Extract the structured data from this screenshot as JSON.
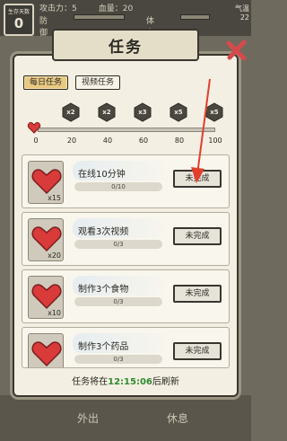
{
  "hud": {
    "box_label": "生存天数",
    "box_value": "0",
    "attack": "攻击力：5",
    "defense": "防御",
    "blood": "血量：20",
    "stamina": "体力",
    "weather": "气温",
    "weather_value": "22"
  },
  "panel": {
    "title": "任务",
    "tabs": [
      {
        "label": "每日任务",
        "active": true
      },
      {
        "label": "视频任务",
        "active": false
      }
    ]
  },
  "milestones": {
    "ticks": [
      "0",
      "20",
      "40",
      "60",
      "80",
      "100"
    ],
    "chests": [
      "x2",
      "x2",
      "x3",
      "x5",
      "x5"
    ],
    "progress": 0
  },
  "tasks": [
    {
      "title": "在线10分钟",
      "progress": "0/10",
      "reward": "x15",
      "button": "未完成"
    },
    {
      "title": "观看3次视频",
      "progress": "0/3",
      "reward": "x20",
      "button": "未完成"
    },
    {
      "title": "制作3个食物",
      "progress": "0/3",
      "reward": "x10",
      "button": "未完成"
    },
    {
      "title": "制作3个药品",
      "progress": "0/3",
      "reward": "x10",
      "button": "未完成"
    }
  ],
  "refresh": {
    "prefix": "任务将在",
    "time": "12:15:06",
    "suffix": "后刷新"
  },
  "bottom": {
    "left": "外出",
    "right": "休息"
  },
  "colors": {
    "accent_tab": "#e9c982",
    "heart": "#d93a3a",
    "time": "#2f8a2f",
    "arrow": "#e0402c"
  }
}
